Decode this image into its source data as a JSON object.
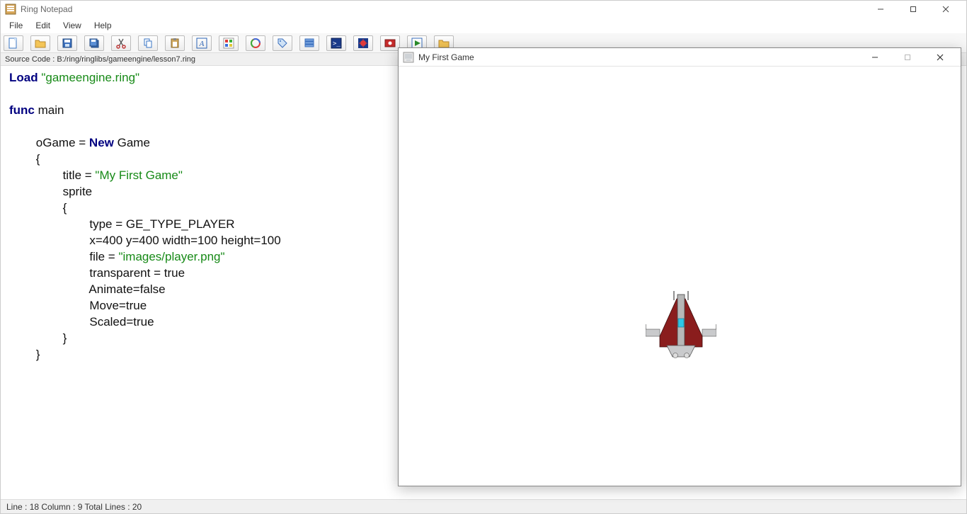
{
  "app": {
    "title": "Ring Notepad",
    "menus": {
      "file": "File",
      "edit": "Edit",
      "view": "View",
      "help": "Help"
    },
    "toolbar_icons": [
      "new-file-icon",
      "open-icon",
      "save-icon",
      "save-all-icon",
      "cut-icon",
      "copy-icon",
      "paste-icon",
      "font-icon",
      "color-icon",
      "ring-icon",
      "tag-icon",
      "stack-icon",
      "debug-cmd-icon",
      "debug-icon",
      "debug-bp-icon",
      "run-icon",
      "open-folder-icon"
    ],
    "source_bar": "Source Code : B:/ring/ringlibs/gameengine/lesson7.ring",
    "code": {
      "l1kw": "Load ",
      "l1str": "\"gameengine.ring\"",
      "l3kw": "func ",
      "l3id": "main",
      "l5a": "        oGame = ",
      "l5kw": "New ",
      "l5b": "Game",
      "l6": "        {",
      "l7a": "                title = ",
      "l7str": "\"My First Game\"",
      "l8": "                sprite",
      "l9": "                {",
      "l10": "                        type = GE_TYPE_PLAYER",
      "l11": "                        x=400 y=400 width=100 height=100",
      "l12a": "                        file = ",
      "l12str": "\"images/player.png\"",
      "l13": "                        transparent = true",
      "l14": "                        Animate=false",
      "l15": "                        Move=true",
      "l16": "                        Scaled=true",
      "l17": "                }",
      "l18": "        }"
    },
    "status": "Line : 18 Column : 9 Total Lines : 20"
  },
  "game_window": {
    "title": "My First Game"
  },
  "colors": {
    "keyword": "#000080",
    "string": "#178a17"
  }
}
